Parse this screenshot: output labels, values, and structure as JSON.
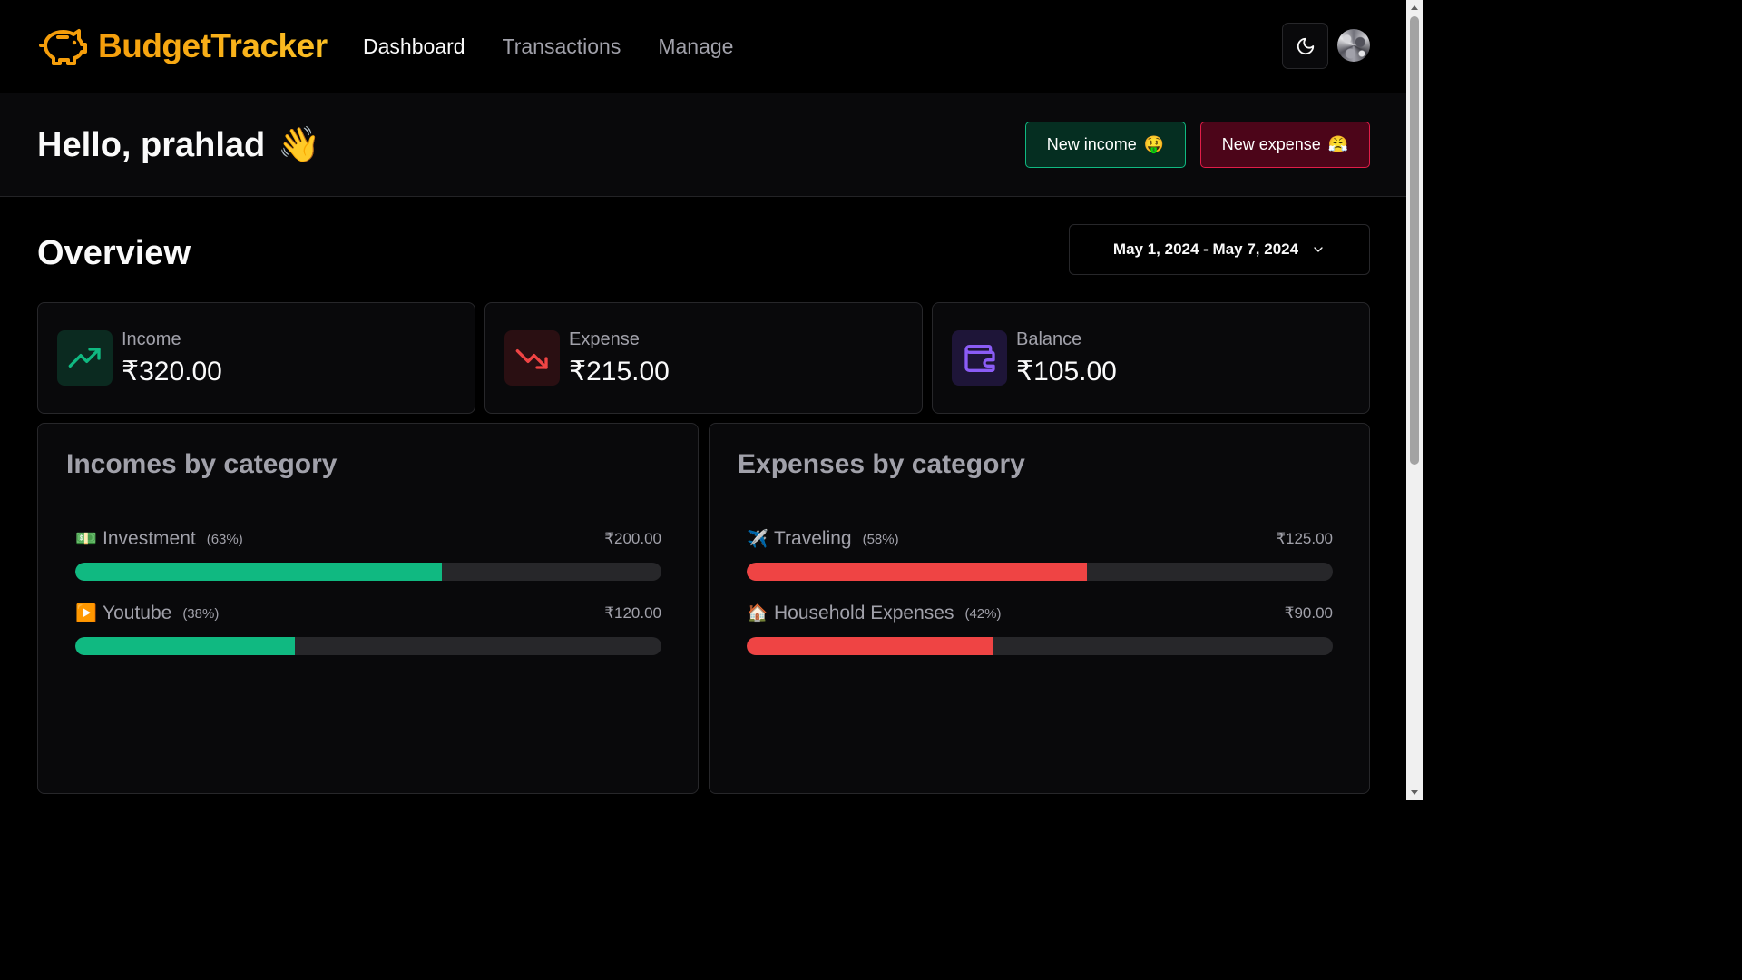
{
  "app": {
    "name": "BudgetTracker"
  },
  "nav": {
    "items": [
      {
        "label": "Dashboard",
        "active": true
      },
      {
        "label": "Transactions",
        "active": false
      },
      {
        "label": "Manage",
        "active": false
      }
    ]
  },
  "header": {
    "theme_icon": "moon-icon",
    "avatar": "user-avatar"
  },
  "greeting": {
    "text": "Hello, prahlad",
    "emoji": "👋"
  },
  "actions": {
    "new_income": {
      "label": "New income",
      "emoji": "🤑"
    },
    "new_expense": {
      "label": "New expense",
      "emoji": "😤"
    }
  },
  "overview": {
    "title": "Overview",
    "date_range": "May 1, 2024 - May 7, 2024"
  },
  "stats": [
    {
      "label": "Income",
      "value": "₹320.00",
      "icon": "trending-up-icon",
      "color": "#10b981"
    },
    {
      "label": "Expense",
      "value": "₹215.00",
      "icon": "trending-down-icon",
      "color": "#ef4444"
    },
    {
      "label": "Balance",
      "value": "₹105.00",
      "icon": "wallet-icon",
      "color": "#8b5cf6"
    }
  ],
  "incomes_by_category": {
    "title": "Incomes by category",
    "color": "#10b981",
    "items": [
      {
        "icon": "💵",
        "name": "Investment",
        "percent_label": "(63%)",
        "amount": "₹200.00",
        "fill": 0.625
      },
      {
        "icon": "▶️",
        "name": "Youtube",
        "percent_label": "(38%)",
        "amount": "₹120.00",
        "fill": 0.375
      }
    ]
  },
  "expenses_by_category": {
    "title": "Expenses by category",
    "color": "#ef4444",
    "items": [
      {
        "icon": "✈️",
        "name": "Traveling",
        "percent_label": "(58%)",
        "amount": "₹125.00",
        "fill": 0.581
      },
      {
        "icon": "🏠",
        "name": "Household Expenses",
        "percent_label": "(42%)",
        "amount": "₹90.00",
        "fill": 0.419
      }
    ]
  }
}
